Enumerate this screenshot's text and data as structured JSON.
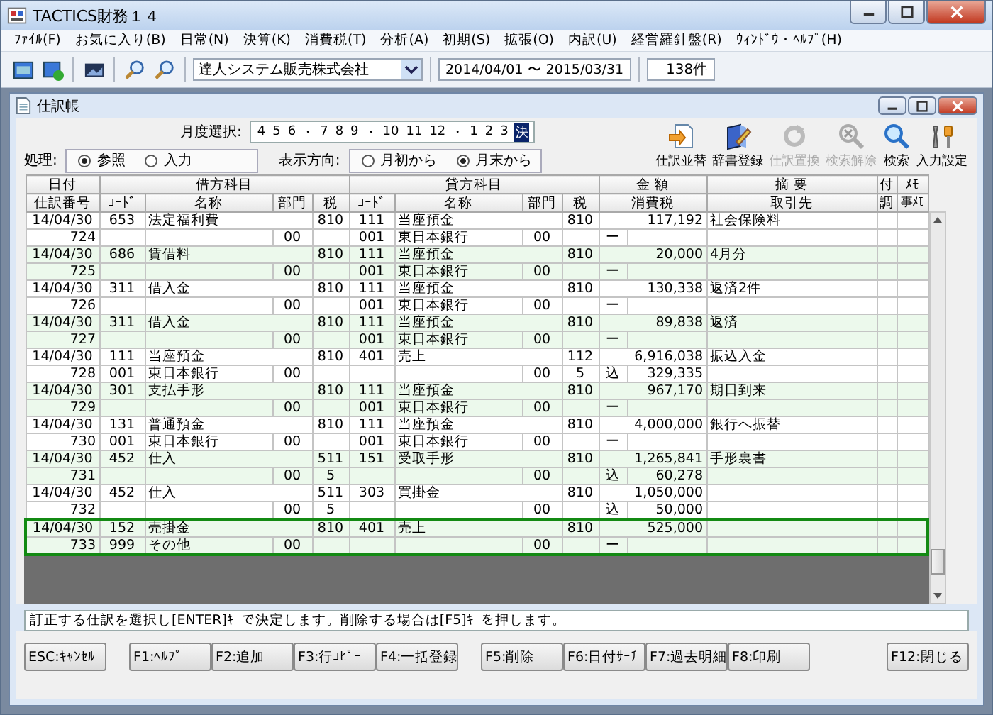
{
  "window": {
    "title": "TACTICS財務１４"
  },
  "menu": [
    "ﾌｧｲﾙ(F)",
    "お気に入り(B)",
    "日常(N)",
    "決算(K)",
    "消費税(T)",
    "分析(A)",
    "初期(S)",
    "拡張(O)",
    "内訳(U)",
    "経営羅針盤(R)",
    "ｳｨﾝﾄﾞｳ・ﾍﾙﾌﾟ(H)"
  ],
  "toolbar": {
    "company": "達人システム販売株式会社",
    "period": "2014/04/01 〜 2015/03/31",
    "count": "138件"
  },
  "child": {
    "title": "仕訳帳",
    "month_selector": {
      "label": "月度選択:",
      "separator": "・",
      "groups": [
        [
          {
            "label": "4",
            "selected": false
          },
          {
            "label": "5",
            "selected": false
          },
          {
            "label": "6",
            "selected": false
          }
        ],
        [
          {
            "label": "7",
            "selected": false
          },
          {
            "label": "8",
            "selected": false
          },
          {
            "label": "9",
            "selected": false
          }
        ],
        [
          {
            "label": "10",
            "selected": false
          },
          {
            "label": "11",
            "selected": false
          },
          {
            "label": "12",
            "selected": false
          }
        ],
        [
          {
            "label": "1",
            "selected": false
          },
          {
            "label": "2",
            "selected": false
          },
          {
            "label": "3",
            "selected": false
          },
          {
            "label": "決",
            "selected": true
          }
        ]
      ]
    },
    "mode": {
      "label": "処理:",
      "options": [
        {
          "label": "参照",
          "selected": true
        },
        {
          "label": "入力",
          "selected": false
        }
      ]
    },
    "direction": {
      "label": "表示方向:",
      "options": [
        {
          "label": "月初から",
          "selected": false
        },
        {
          "label": "月末から",
          "selected": true
        }
      ]
    },
    "actions": [
      {
        "label": "仕訳並替",
        "kind": "sort",
        "disabled": false
      },
      {
        "label": "辞書登録",
        "kind": "dictionary",
        "disabled": false
      },
      {
        "label": "仕訳置換",
        "kind": "replace",
        "disabled": true
      },
      {
        "label": "検索解除",
        "kind": "clear",
        "disabled": true
      },
      {
        "label": "検索",
        "kind": "search",
        "disabled": false
      },
      {
        "label": "入力設定",
        "kind": "settings",
        "disabled": false
      }
    ],
    "table": {
      "header_top": [
        "日付",
        "借方科目",
        "貸方科目",
        "金 額",
        "摘 要",
        "付",
        "ﾒﾓ"
      ],
      "header_bottom": [
        "仕訳番号",
        "ｺｰﾄﾞ",
        "名称",
        "部門",
        "税",
        "ｺｰﾄﾞ",
        "名称",
        "部門",
        "税",
        "消費税",
        "取引先",
        "調",
        "事ﾒﾓ"
      ],
      "entries": [
        {
          "selected": false,
          "date": "14/04/30",
          "debit_code": "653",
          "debit_name": "法定福利費",
          "debit_tax": "810",
          "credit_code": "111",
          "credit_name": "当座預金",
          "credit_tax": "810",
          "amount": "117,192",
          "summary": "社会保険料",
          "number": "724",
          "debit_dept": "00",
          "credit_sub_code": "001",
          "credit_sub_name": "東日本銀行",
          "credit_dept": "00",
          "tax_mark": "ー"
        },
        {
          "selected": false,
          "date": "14/04/30",
          "debit_code": "686",
          "debit_name": "賃借料",
          "debit_tax": "810",
          "credit_code": "111",
          "credit_name": "当座預金",
          "credit_tax": "810",
          "amount": "20,000",
          "summary": "4月分",
          "number": "725",
          "debit_dept": "00",
          "credit_sub_code": "001",
          "credit_sub_name": "東日本銀行",
          "credit_dept": "00",
          "tax_mark": "ー"
        },
        {
          "selected": false,
          "date": "14/04/30",
          "debit_code": "311",
          "debit_name": "借入金",
          "debit_tax": "810",
          "credit_code": "111",
          "credit_name": "当座預金",
          "credit_tax": "810",
          "amount": "130,338",
          "summary": "返済2件",
          "number": "726",
          "debit_dept": "00",
          "credit_sub_code": "001",
          "credit_sub_name": "東日本銀行",
          "credit_dept": "00",
          "tax_mark": "ー"
        },
        {
          "selected": false,
          "date": "14/04/30",
          "debit_code": "311",
          "debit_name": "借入金",
          "debit_tax": "810",
          "credit_code": "111",
          "credit_name": "当座預金",
          "credit_tax": "810",
          "amount": "89,838",
          "summary": "返済",
          "number": "727",
          "debit_dept": "00",
          "credit_sub_code": "001",
          "credit_sub_name": "東日本銀行",
          "credit_dept": "00",
          "tax_mark": "ー"
        },
        {
          "selected": false,
          "date": "14/04/30",
          "debit_code": "111",
          "debit_name": "当座預金",
          "debit_tax": "810",
          "credit_code": "401",
          "credit_name": "売上",
          "credit_tax": "112",
          "amount": "6,916,038",
          "summary": "振込入金",
          "number": "728",
          "debit_sub_code": "001",
          "debit_sub_name": "東日本銀行",
          "debit_dept": "00",
          "credit_dept": "00",
          "credit_tax_rate": "5",
          "tax_mark": "込",
          "tax_amount": "329,335"
        },
        {
          "selected": false,
          "date": "14/04/30",
          "debit_code": "301",
          "debit_name": "支払手形",
          "debit_tax": "810",
          "credit_code": "111",
          "credit_name": "当座預金",
          "credit_tax": "810",
          "amount": "967,170",
          "summary": "期日到来",
          "number": "729",
          "debit_dept": "00",
          "credit_sub_code": "001",
          "credit_sub_name": "東日本銀行",
          "credit_dept": "00",
          "tax_mark": "ー"
        },
        {
          "selected": false,
          "date": "14/04/30",
          "debit_code": "131",
          "debit_name": "普通預金",
          "debit_tax": "810",
          "credit_code": "111",
          "credit_name": "当座預金",
          "credit_tax": "810",
          "amount": "4,000,000",
          "summary": "銀行へ振替",
          "number": "730",
          "debit_sub_code": "001",
          "debit_sub_name": "東日本銀行",
          "debit_dept": "00",
          "credit_sub_code": "001",
          "credit_sub_name": "東日本銀行",
          "credit_dept": "00",
          "tax_mark": "ー"
        },
        {
          "selected": false,
          "date": "14/04/30",
          "debit_code": "452",
          "debit_name": "仕入",
          "debit_tax": "511",
          "credit_code": "151",
          "credit_name": "受取手形",
          "credit_tax": "810",
          "amount": "1,265,841",
          "summary": "手形裏書",
          "number": "731",
          "debit_dept": "00",
          "debit_tax_rate": "5",
          "credit_dept": "00",
          "tax_mark": "込",
          "tax_amount": "60,278"
        },
        {
          "selected": false,
          "date": "14/04/30",
          "debit_code": "452",
          "debit_name": "仕入",
          "debit_tax": "511",
          "credit_code": "303",
          "credit_name": "買掛金",
          "credit_tax": "810",
          "amount": "1,050,000",
          "number": "732",
          "debit_dept": "00",
          "debit_tax_rate": "5",
          "credit_dept": "00",
          "tax_mark": "込",
          "tax_amount": "50,000"
        },
        {
          "selected": true,
          "date": "14/04/30",
          "debit_code": "152",
          "debit_name": "売掛金",
          "debit_tax": "810",
          "credit_code": "401",
          "credit_name": "売上",
          "credit_tax": "810",
          "amount": "525,000",
          "number": "733",
          "debit_sub_code": "999",
          "debit_sub_name": "その他",
          "debit_dept": "00",
          "credit_dept": "00",
          "tax_mark": "ー"
        }
      ]
    },
    "message": "訂正する仕訳を選択し[ENTER]ｷｰで決定します。削除する場合は[F5]ｷｰを押します。",
    "function_keys": [
      [
        "ESC:ｷｬﾝｾﾙ"
      ],
      [
        "F1:ﾍﾙﾌﾟ",
        "F2:追加",
        "F3:行ｺﾋﾟｰ",
        "F4:一括登録"
      ],
      [
        "F5:削除",
        "F6:日付ｻｰﾁ",
        "F7:過去明細",
        "F8:印刷"
      ],
      [
        "F12:閉じる"
      ]
    ]
  }
}
